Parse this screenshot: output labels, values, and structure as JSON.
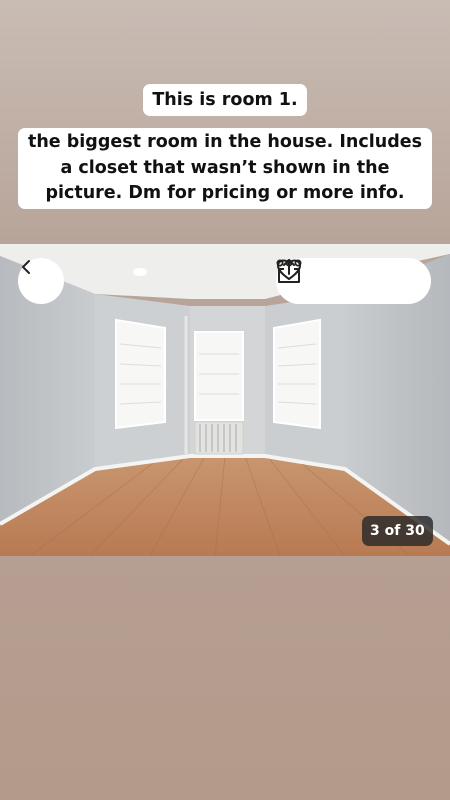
{
  "captions": {
    "title": "This is room 1.",
    "body_lines": [
      "the biggest room in the house. Includes",
      "a closet that wasn’t shown in the",
      "picture. Dm for pricing or more info."
    ]
  },
  "photo": {
    "counter": "3 of 30",
    "icons": {
      "back": "chevron-left-icon",
      "save": "heart-icon",
      "share": "share-icon",
      "more": "more-dots-icon"
    }
  }
}
